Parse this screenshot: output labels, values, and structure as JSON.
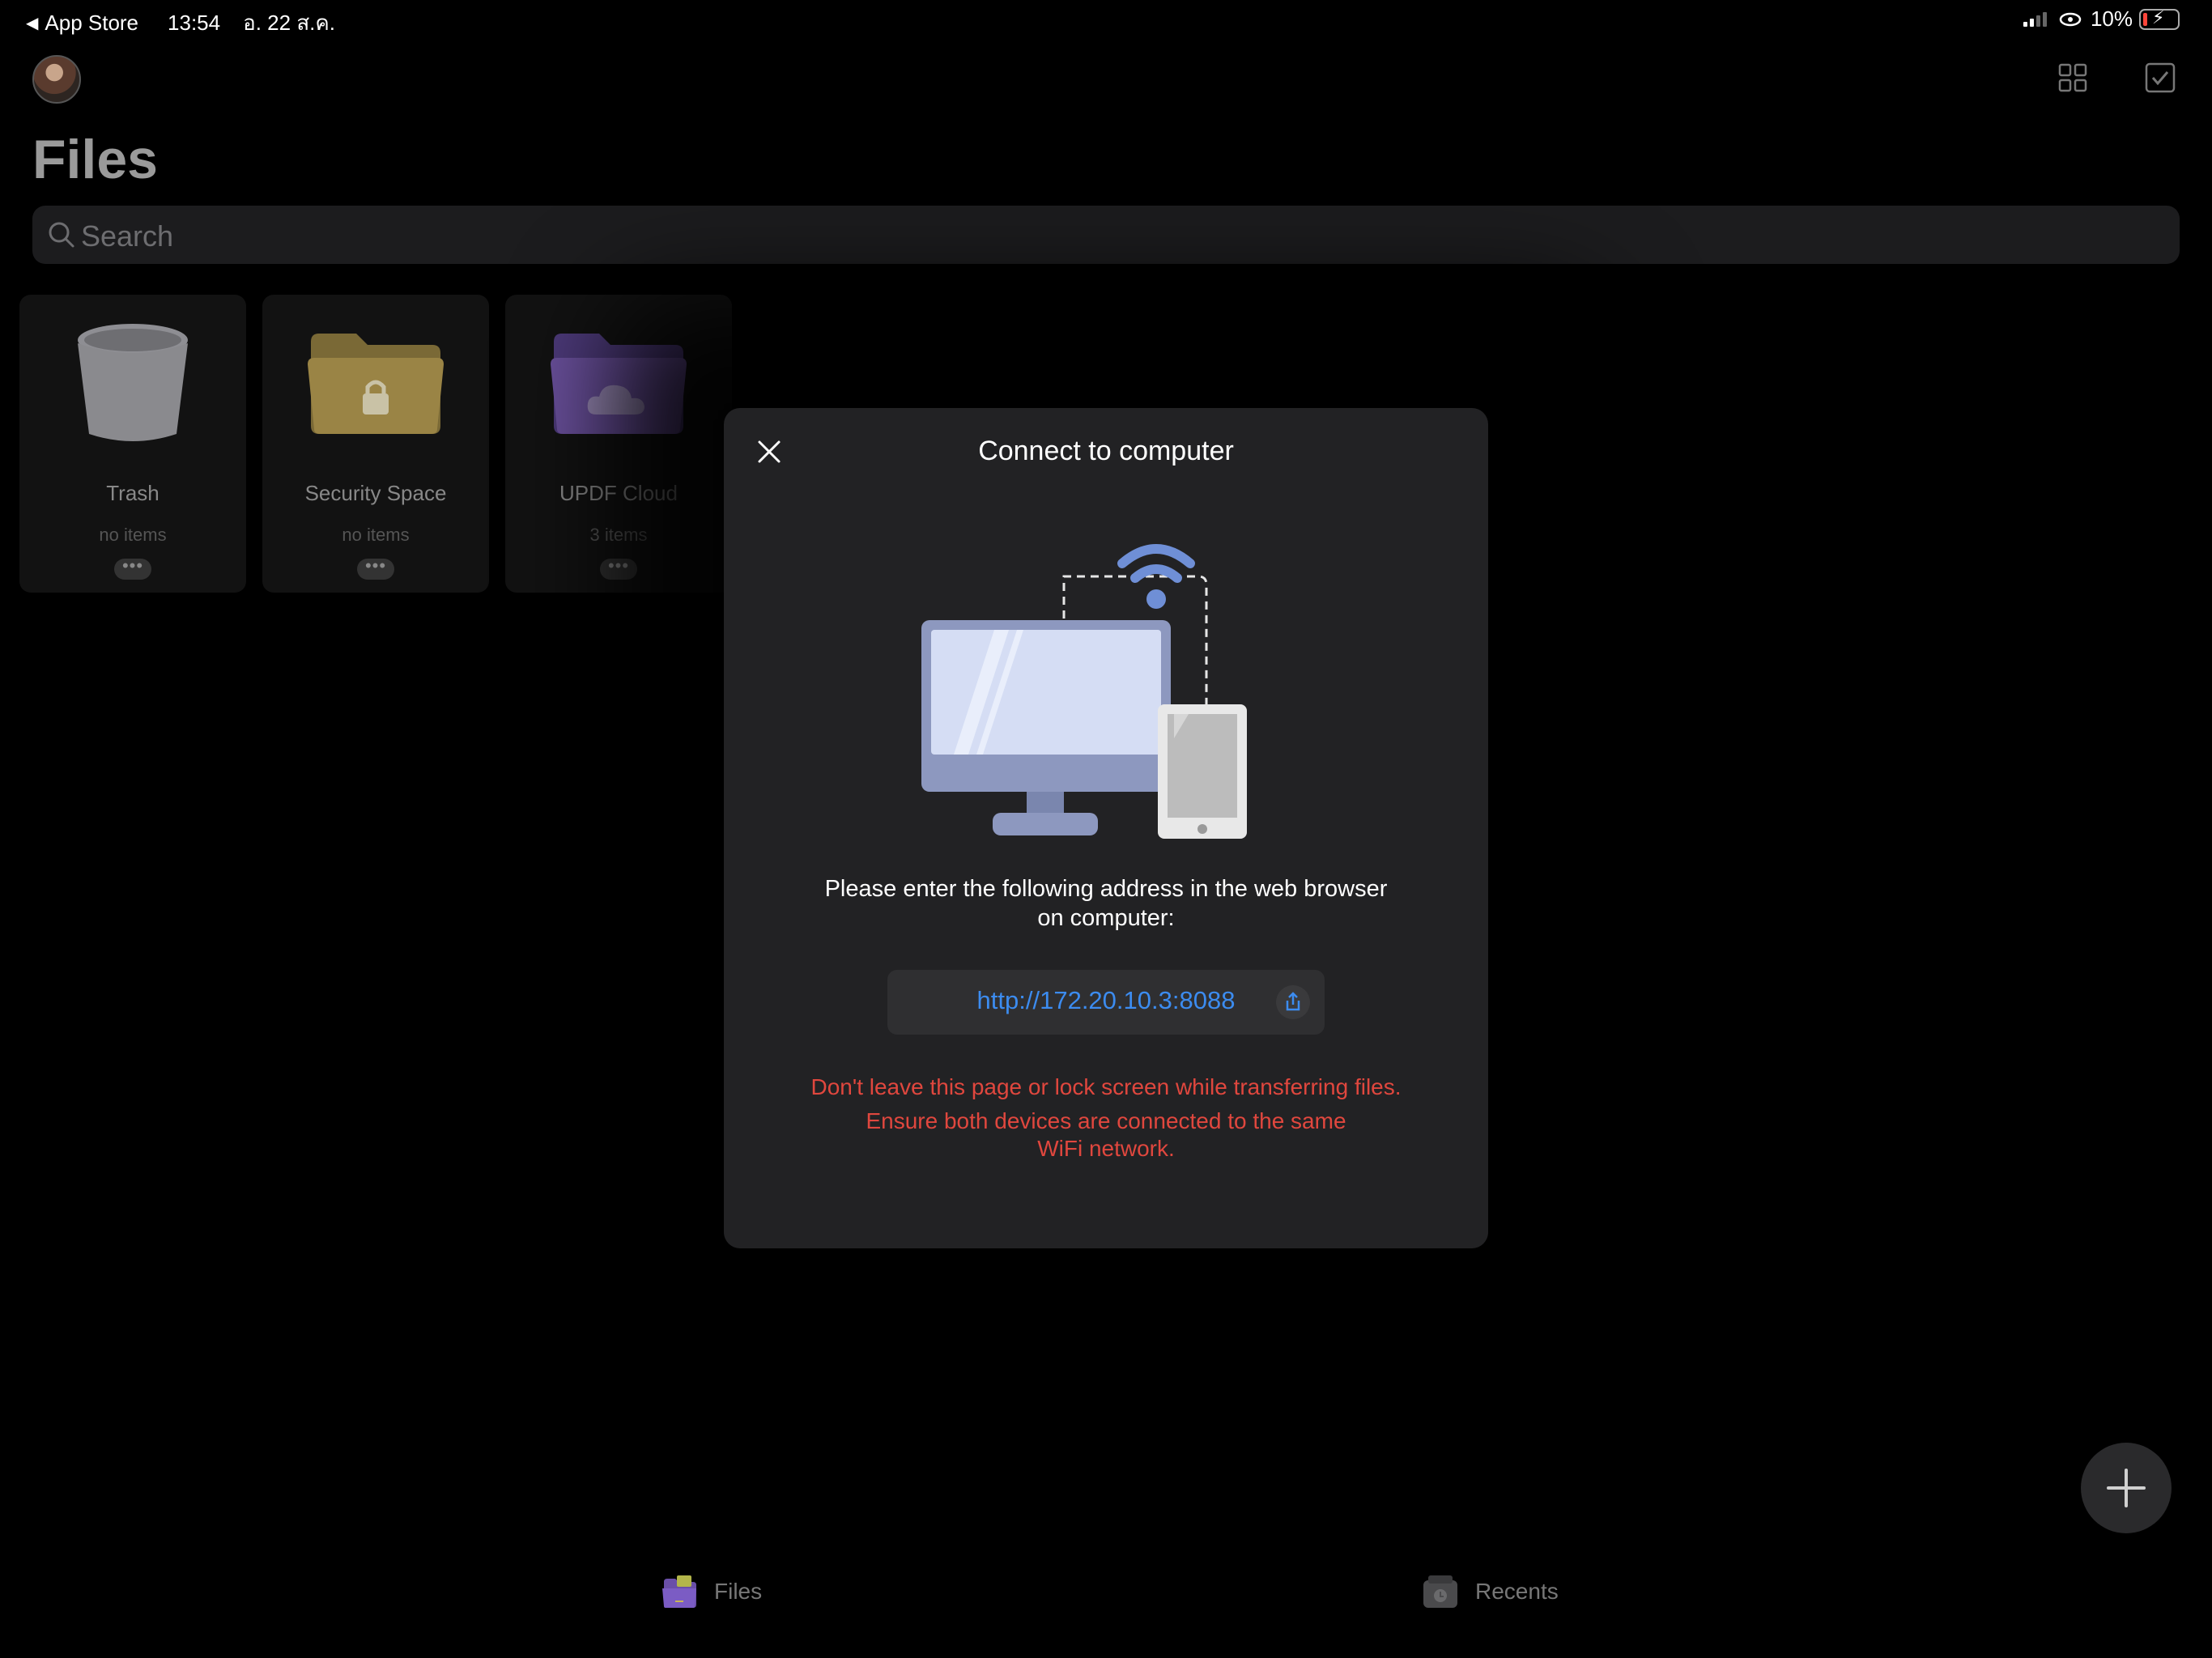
{
  "status_bar": {
    "back_app": "App Store",
    "time": "13:54",
    "date": "อ. 22 ส.ค.",
    "battery": "10%"
  },
  "header": {
    "title": "Files",
    "grid_icon": "grid-view-icon",
    "select_icon": "checkbox-select-icon"
  },
  "search": {
    "placeholder": "Search"
  },
  "folders": [
    {
      "name": "Trash",
      "count": "no items",
      "icon": "trash-icon"
    },
    {
      "name": "Security Space",
      "count": "no items",
      "icon": "locked-folder-icon"
    },
    {
      "name": "UPDF Cloud",
      "count": "3 items",
      "icon": "cloud-folder-icon"
    }
  ],
  "modal": {
    "title": "Connect to computer",
    "instruction_line1": "Please enter the following address in the web browser",
    "instruction_line2": "on computer:",
    "address": "http://172.20.10.3:8088",
    "warning1": "Don't leave this page or lock screen while transferring files.",
    "warning2_line1": "Ensure both devices are connected to the same",
    "warning2_line2": "WiFi network."
  },
  "tabs": [
    {
      "label": "Files",
      "icon": "files-tab-icon",
      "active": true
    },
    {
      "label": "Recents",
      "icon": "recents-tab-icon",
      "active": false
    }
  ],
  "colors": {
    "link": "#3c8cf0",
    "warning": "#e0473e",
    "modal_bg": "#222224",
    "accent_purple": "#7b5cc4"
  }
}
